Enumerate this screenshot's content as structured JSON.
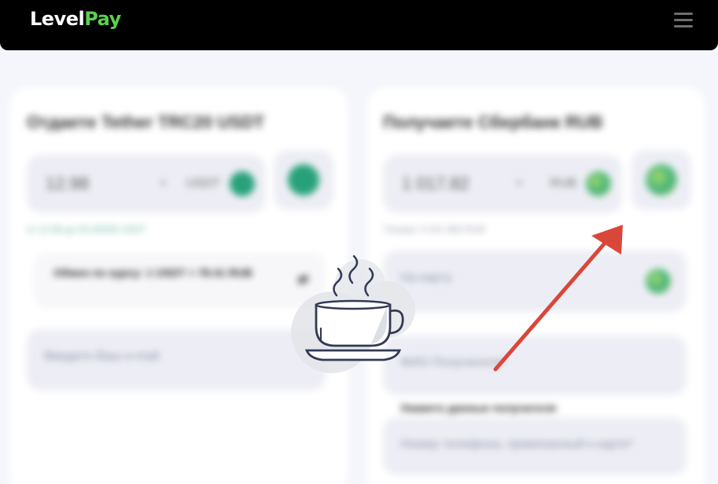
{
  "header": {
    "logo_part1": "Level",
    "logo_part2": "Pay",
    "menu_icon": "hamburger-menu-icon"
  },
  "give": {
    "title": "Отдаете Tether TRC20 USDT",
    "amount": "12.98",
    "currency": "USDT",
    "x": "×",
    "coin_icon": "tether-icon",
    "hint": "от 12.98 до 53.45936 USDT",
    "rate": "Обмен по курсу: 1 USDT = 78.41 RUB",
    "rate_icon_text": "⇄",
    "email_placeholder": "Введите Ваш e-mail"
  },
  "receive": {
    "title": "Получаете Сбербанк RUB",
    "amount": "1 017.82",
    "currency": "RUB",
    "x": "×",
    "coin_icon": "sberbank-icon",
    "hint": "Резерв: 5 541 983 RUB",
    "card_placeholder": "На карту",
    "name_placeholder": "ФИО Получателя*",
    "recipient_label": "Укажите данные получателя",
    "phone_placeholder": "Номер телефона, привязанный к карте*"
  },
  "overlay": {
    "icon": "coffee-cup-icon"
  },
  "colors": {
    "brand_green": "#5ad14b",
    "annotation_arrow": "#d9473a"
  }
}
